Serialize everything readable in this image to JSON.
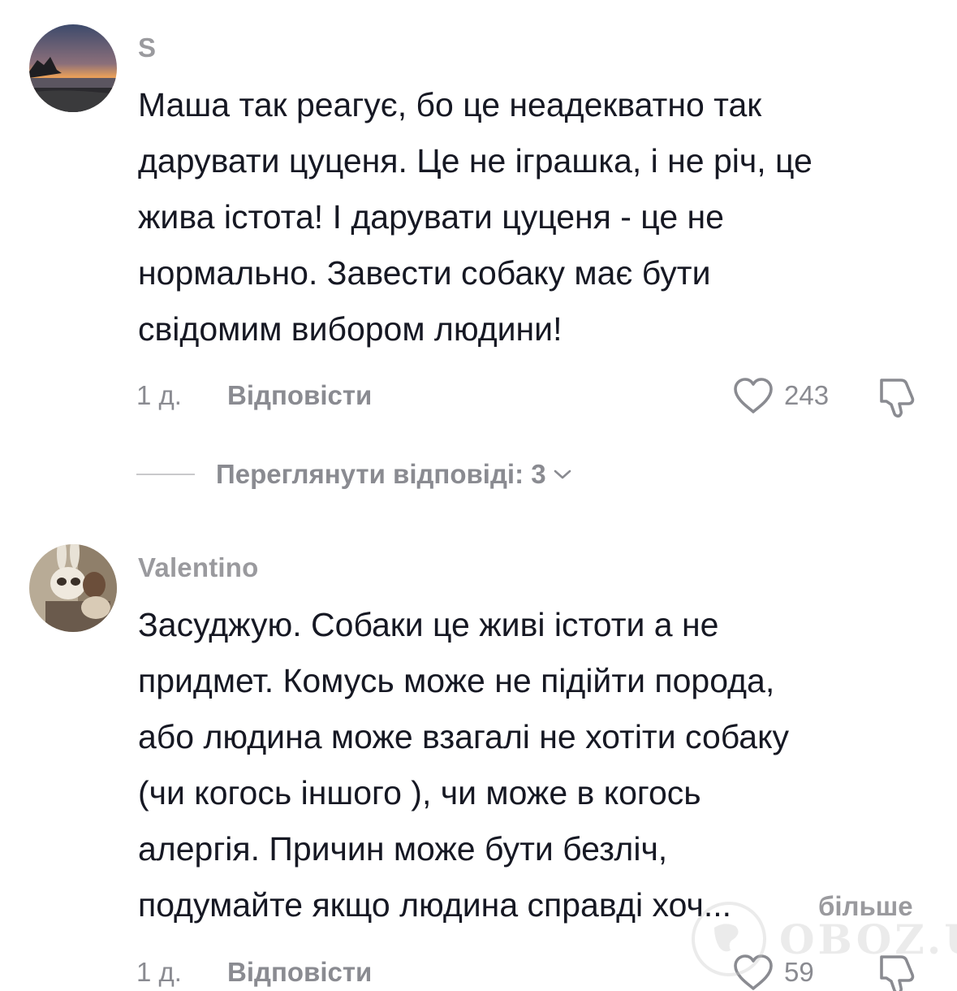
{
  "comments": [
    {
      "username": "S",
      "avatar": "sunset-lake-avatar",
      "text_lines": [
        "Маша так реагує, бо це неадекватно так",
        "дарувати цуценя. Це не іграшка, і не річ, це",
        "жива істота! І дарувати цуценя - це не",
        "нормально. Завести собаку має бути",
        "свідомим вибором людини!"
      ],
      "time": "1 д.",
      "reply_label": "Відповісти",
      "likes": "243",
      "view_replies": "Переглянути відповіді: 3"
    },
    {
      "username": "Valentino",
      "avatar": "bunny-mask-avatar",
      "text_lines": [
        "Засуджую. Собаки це живі істоти а не",
        "придмет. Комусь може не підійти порода,",
        "або людина може взагалі не хотіти собаку",
        "(чи когось іншого ), чи може в когось",
        "алергія. Причин може бути безліч,",
        "подумайте якщо людина справді хоч..."
      ],
      "more_label": "більше",
      "time": "1 д.",
      "reply_label": "Відповісти",
      "likes": "59"
    }
  ],
  "icons": {
    "like": "heart-outline-icon",
    "dislike": "thumbs-down-icon",
    "expand": "chevron-down-icon"
  },
  "watermark": "OBOZ.UA",
  "colors": {
    "text": "#161823",
    "muted": "#8a8b91",
    "username": "#9a9a9e"
  }
}
